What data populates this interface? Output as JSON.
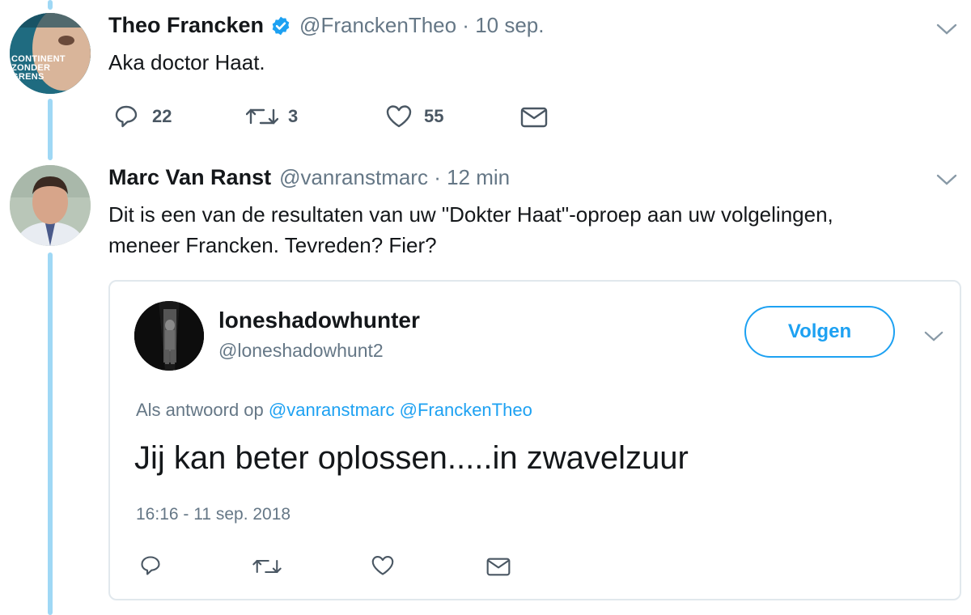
{
  "tweet1": {
    "display_name": "Theo Francken",
    "handle_time": "@FranckenTheo · 10 sep.",
    "text": "Aka doctor Haat.",
    "avatar_text": [
      "CONTINENT",
      "ZONDER",
      "GRENS"
    ],
    "replies": "22",
    "retweets": "3",
    "likes": "55"
  },
  "tweet2": {
    "display_name": "Marc Van Ranst",
    "handle_time": "@vanranstmarc · 12 min",
    "text_line1": "Dit is een van de resultaten van uw \"Dokter Haat\"-oproep aan uw volgelingen,",
    "text_line2": "meneer Francken. Tevreden? Fier?"
  },
  "quoted": {
    "display_name": "loneshadowhunter",
    "handle": "@loneshadowhunt2",
    "follow_label": "Volgen",
    "reply_prefix": "Als antwoord op",
    "mention1": "@vanranstmarc",
    "mention2": "@FranckenTheo",
    "text": "Jij kan beter oplossen.....in zwavelzuur",
    "timestamp": "16:16 - 11 sep. 2018"
  },
  "colors": {
    "accent": "#1da1f2",
    "thread_line": "#9fd8f5",
    "muted": "#657786"
  },
  "icons": [
    "verified-badge-icon",
    "chevron-down-icon",
    "reply-icon",
    "retweet-icon",
    "like-icon",
    "direct-message-icon"
  ]
}
